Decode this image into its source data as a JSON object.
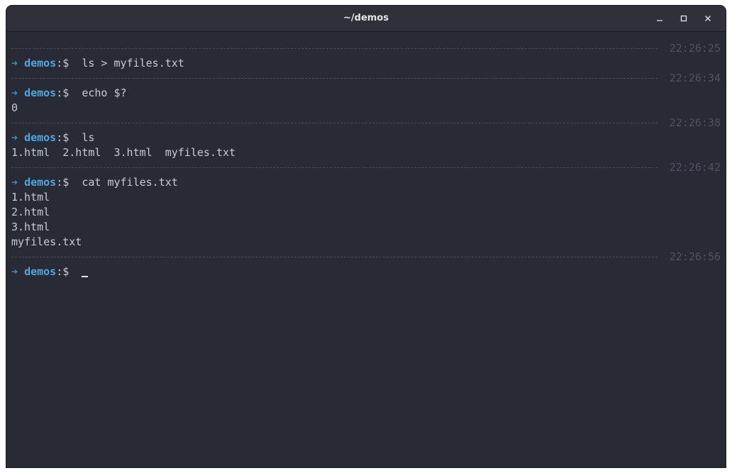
{
  "window": {
    "title": "~/demos"
  },
  "controls": {
    "minimize_icon": "minimize-icon",
    "maximize_icon": "maximize-icon",
    "close_icon": "close-icon"
  },
  "prompt": {
    "arrow": "➔",
    "dir": "demos",
    "symbol": ":$"
  },
  "blocks": [
    {
      "timestamp": "22:26:25",
      "command": "ls > myfiles.txt",
      "output": []
    },
    {
      "timestamp": "22:26:34",
      "command": "echo $?",
      "output": [
        "0"
      ]
    },
    {
      "timestamp": "22:26:38",
      "command": "ls",
      "output": [
        "1.html  2.html  3.html  myfiles.txt"
      ]
    },
    {
      "timestamp": "22:26:42",
      "command": "cat myfiles.txt",
      "output": [
        "1.html",
        "2.html",
        "3.html",
        "myfiles.txt"
      ]
    },
    {
      "timestamp": "22:26:56",
      "command": "",
      "output": [],
      "active": true
    }
  ],
  "colors": {
    "background": "#282a36",
    "prompt_accent": "#4ea8df",
    "timestamp": "#4e5263"
  }
}
